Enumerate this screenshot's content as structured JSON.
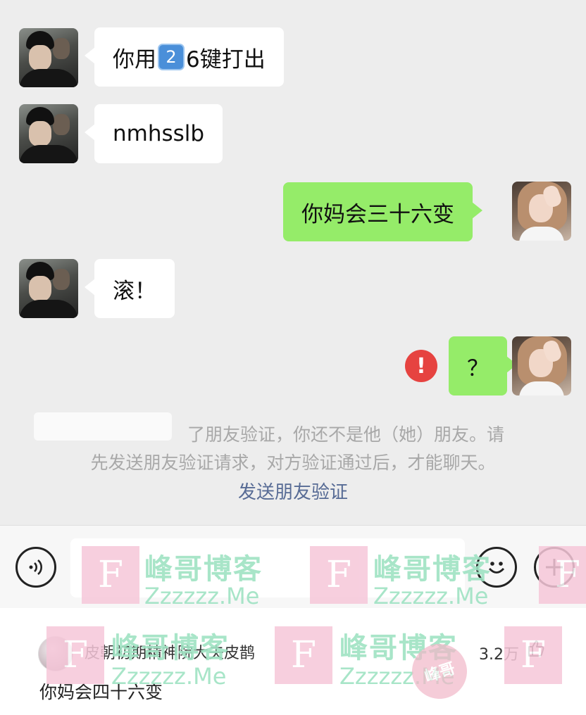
{
  "messages": [
    {
      "side": "left",
      "text_prefix": "你用",
      "keycap": "2",
      "text_suffix": "6键打出"
    },
    {
      "side": "left",
      "text": "nmhsslb"
    },
    {
      "side": "right",
      "text": "你妈会三十六变"
    },
    {
      "side": "left",
      "text": "滚！"
    },
    {
      "side": "right",
      "text": "？",
      "failed": true
    }
  ],
  "error_icon_text": "!",
  "system_notice": {
    "line1": "了朋友验证，你还不是他（她）朋友。请",
    "line2": "先发送朋友验证请求，对方验证通过后，才能聊天。",
    "link": "发送朋友验证"
  },
  "input_bar": {
    "voice_icon": "voice-icon",
    "emoji_icon": "emoji-icon",
    "plus_icon": "plus-icon"
  },
  "comment": {
    "author": "皮朝初期精神院大夫皮鹊",
    "likes": "3.2万",
    "text": "你妈会四十六变"
  },
  "watermark": {
    "tile_letter": "F",
    "title": "峰哥博客",
    "subtitle": "Zzzzzz.Me",
    "stamp_text": "峰哥"
  },
  "colors": {
    "background": "#ededed",
    "bubble_sent": "#95ec69",
    "bubble_received": "#ffffff",
    "error": "#e64340",
    "link": "#576b95",
    "watermark_green": "#9fe3c3",
    "watermark_pink": "#f6c7d9"
  }
}
